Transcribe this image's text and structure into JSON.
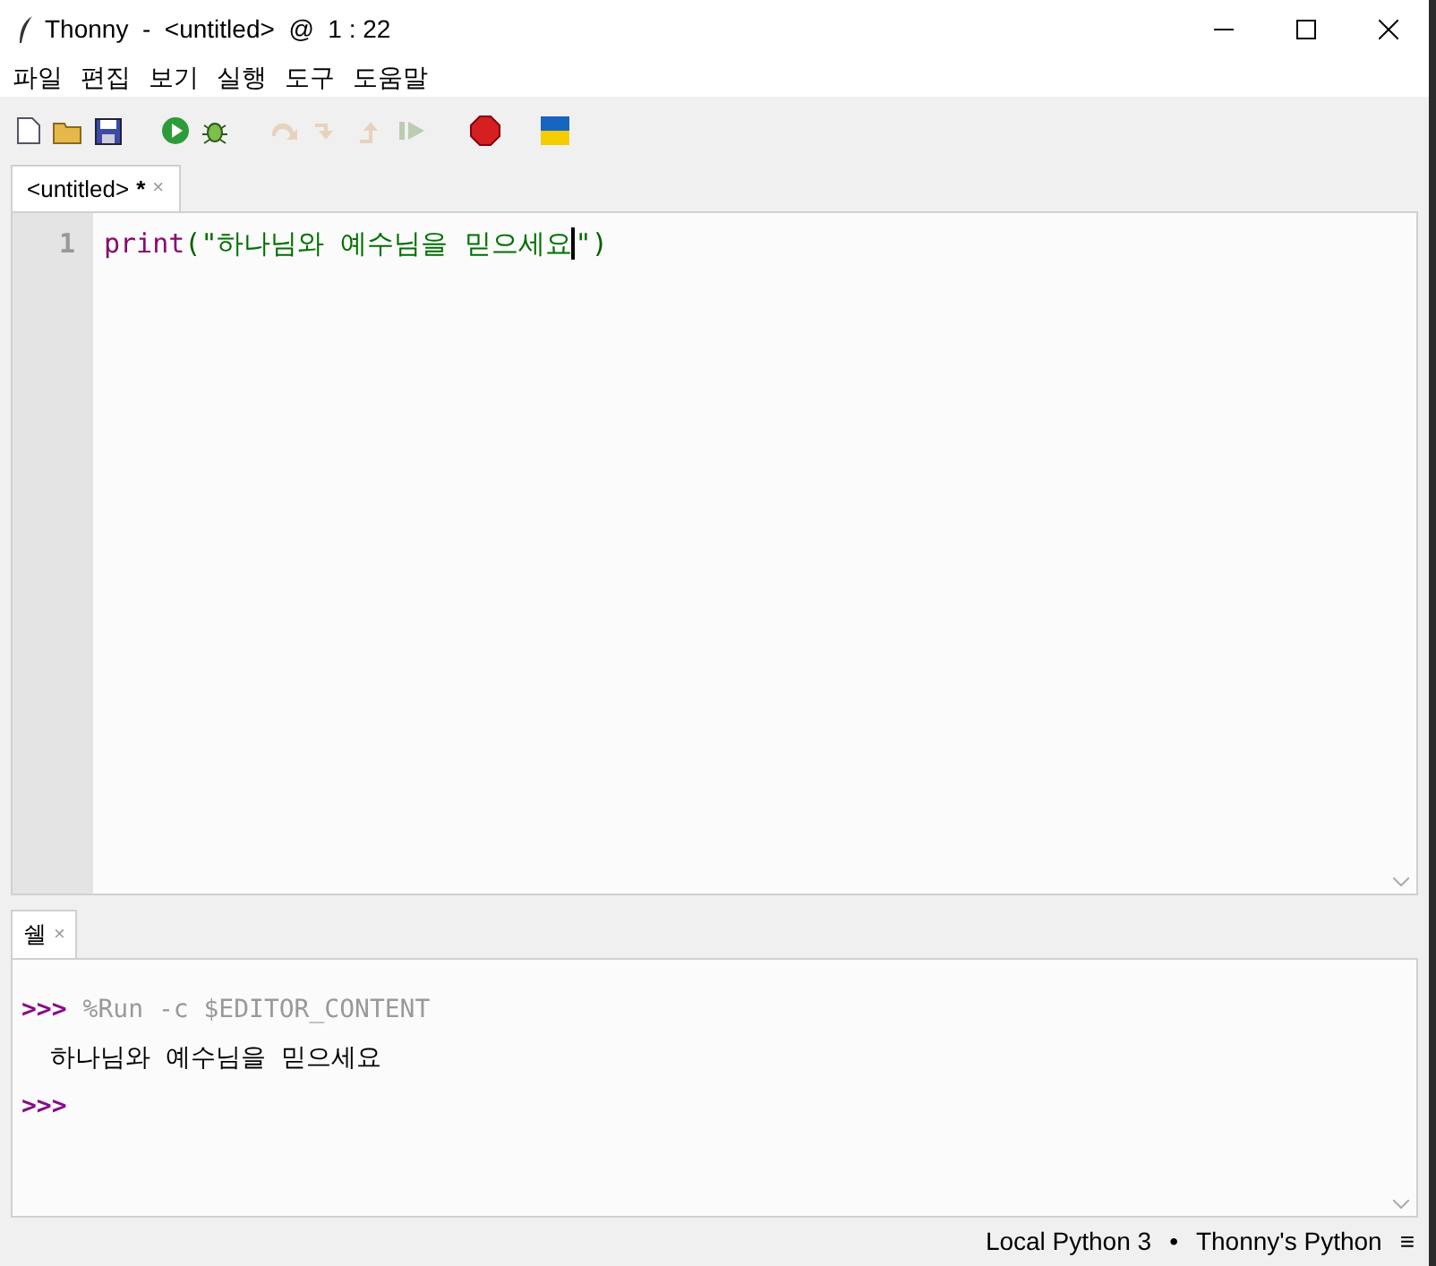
{
  "window": {
    "title": "Thonny  -  <untitled>  @  1 : 22"
  },
  "menu": [
    "파일",
    "편집",
    "보기",
    "실행",
    "도구",
    "도움말"
  ],
  "toolbar": [
    {
      "kind": "new",
      "disabled": false
    },
    {
      "kind": "open",
      "disabled": false
    },
    {
      "kind": "save",
      "disabled": false
    },
    {
      "kind": "gap"
    },
    {
      "kind": "run",
      "disabled": false
    },
    {
      "kind": "debug",
      "disabled": false
    },
    {
      "kind": "gap"
    },
    {
      "kind": "step-over",
      "disabled": true
    },
    {
      "kind": "step-into",
      "disabled": true
    },
    {
      "kind": "step-out",
      "disabled": true
    },
    {
      "kind": "resume",
      "disabled": true
    },
    {
      "kind": "gap"
    },
    {
      "kind": "stop",
      "disabled": false
    },
    {
      "kind": "gap"
    },
    {
      "kind": "flag",
      "disabled": false
    }
  ],
  "editor_tabs": [
    {
      "label": "<untitled>",
      "modified": "*",
      "close": "×",
      "selected": true
    }
  ],
  "editor": {
    "line_number": "1",
    "tokens": [
      {
        "kind": "builtin",
        "text": "print"
      },
      {
        "kind": "paren",
        "text": "("
      },
      {
        "kind": "string",
        "text": "\"하나님와 예수님을 믿으세요"
      },
      {
        "kind": "cursor"
      },
      {
        "kind": "string",
        "text": "\""
      },
      {
        "kind": "paren",
        "text": ")"
      }
    ]
  },
  "shell_tabs": [
    {
      "label": "쉘",
      "close": "×",
      "selected": true
    }
  ],
  "shell": [
    {
      "kind": "command",
      "prompt": ">>>",
      "text": "%Run -c $EDITOR_CONTENT"
    },
    {
      "kind": "output",
      "text": "하나님와 예수님을 믿으세요"
    },
    {
      "kind": "command",
      "prompt": ">>>"
    }
  ],
  "status_bar": {
    "backend": "Local Python 3",
    "separator": "•",
    "interpreter": "Thonny's Python",
    "menu": "≡"
  }
}
